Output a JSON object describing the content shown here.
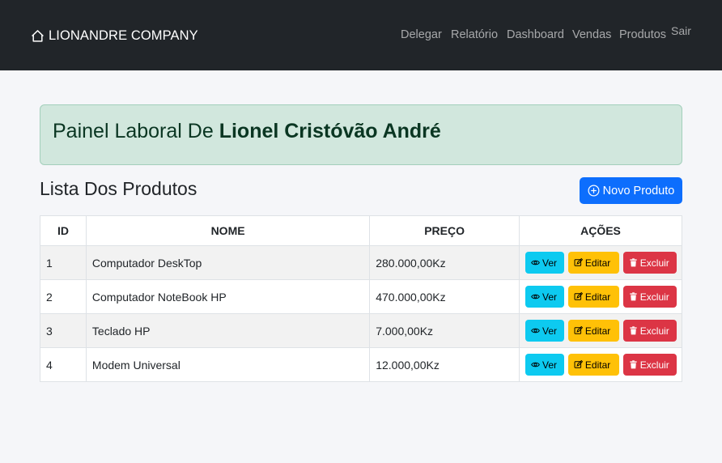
{
  "navbar": {
    "brand": "LIONANDRE COMPANY",
    "brand_icon": "house-icon",
    "links": [
      "Delegar",
      "Relatório",
      "Dashboard",
      "Vendas",
      "Produtos",
      "Sair"
    ]
  },
  "alert": {
    "prefix": "Painel Laboral De",
    "user_name": "Lionel Cristóvão André"
  },
  "products": {
    "title": "Lista Dos Produtos",
    "new_button": "Novo Produto",
    "columns": [
      "ID",
      "NOME",
      "PREÇO",
      "AÇÕES"
    ],
    "rows": [
      {
        "id": "1",
        "name": "Computador DeskTop",
        "price": "280.000,00Kz"
      },
      {
        "id": "2",
        "name": "Computador NoteBook HP",
        "price": "470.000,00Kz"
      },
      {
        "id": "3",
        "name": "Teclado HP",
        "price": "7.000,00Kz"
      },
      {
        "id": "4",
        "name": "Modem Universal",
        "price": "12.000,00Kz"
      }
    ],
    "actions": {
      "view": "Ver",
      "edit": "Editar",
      "delete": "Excluir"
    }
  },
  "colors": {
    "navbar_bg": "#212529",
    "alert_bg": "#d1e7dd",
    "primary": "#0d6efd",
    "info": "#0dcaf0",
    "warning": "#ffc107",
    "danger": "#dc3545"
  }
}
